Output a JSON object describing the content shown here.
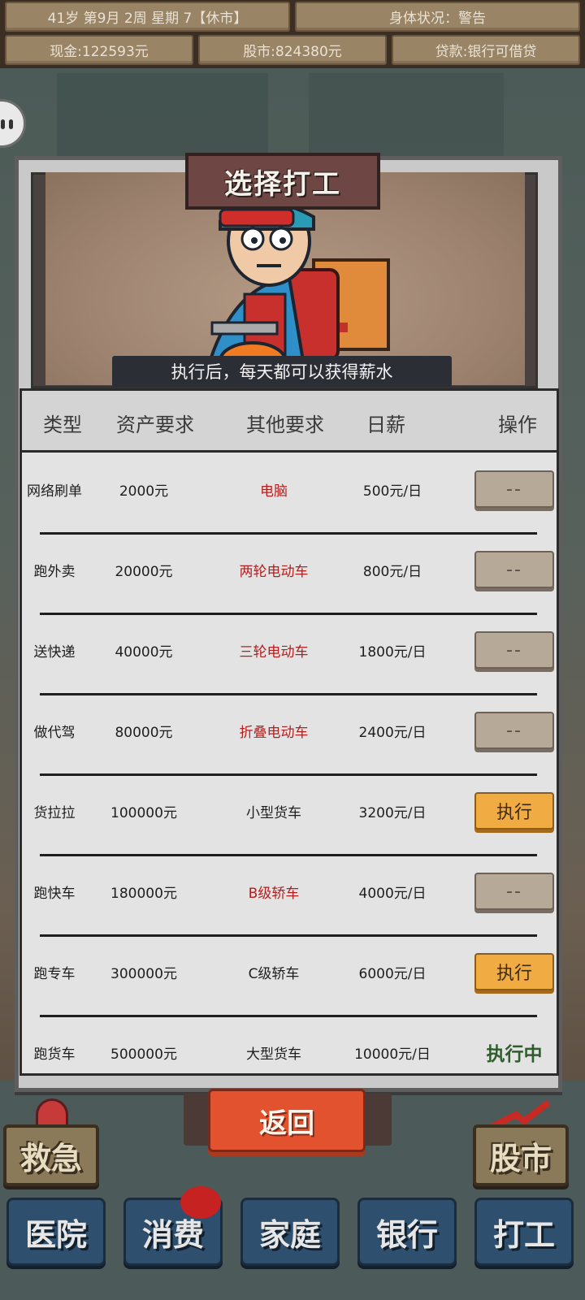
{
  "status": {
    "date": "41岁 第9月 2周 星期 7【休市】",
    "health": "身体状况：警告",
    "cash": "现金:122593元",
    "stock": "股市:824380元",
    "loan": "贷款:银行可借贷"
  },
  "dialog": {
    "title": "选择打工",
    "caption": "执行后，每天都可以获得薪水"
  },
  "table": {
    "headers": [
      "类型",
      "资产要求",
      "其他要求",
      "日薪",
      "操作"
    ],
    "rows": [
      {
        "type": "网络刷单",
        "asset": "2000元",
        "other": "电脑",
        "pay": "500元/日",
        "action": "--",
        "state": "disabled",
        "other_red": true
      },
      {
        "type": "跑外卖",
        "asset": "20000元",
        "other": "两轮电动车",
        "pay": "800元/日",
        "action": "--",
        "state": "disabled",
        "other_red": true
      },
      {
        "type": "送快递",
        "asset": "40000元",
        "other": "三轮电动车",
        "pay": "1800元/日",
        "action": "--",
        "state": "disabled",
        "other_red": true
      },
      {
        "type": "做代驾",
        "asset": "80000元",
        "other": "折叠电动车",
        "pay": "2400元/日",
        "action": "--",
        "state": "disabled",
        "other_red": true
      },
      {
        "type": "货拉拉",
        "asset": "100000元",
        "other": "小型货车",
        "pay": "3200元/日",
        "action": "执行",
        "state": "enabled",
        "other_red": false
      },
      {
        "type": "跑快车",
        "asset": "180000元",
        "other": "B级轿车",
        "pay": "4000元/日",
        "action": "--",
        "state": "disabled",
        "other_red": true
      },
      {
        "type": "跑专车",
        "asset": "300000元",
        "other": "C级轿车",
        "pay": "6000元/日",
        "action": "执行",
        "state": "enabled",
        "other_red": false
      },
      {
        "type": "跑货车",
        "asset": "500000元",
        "other": "大型货车",
        "pay": "10000元/日",
        "action": "执行中",
        "state": "running",
        "other_red": false
      }
    ]
  },
  "back_label": "返回",
  "side_buttons": {
    "emergency": "救急",
    "stock_market": "股市"
  },
  "nav": [
    "医院",
    "消费",
    "家庭",
    "银行",
    "打工"
  ]
}
